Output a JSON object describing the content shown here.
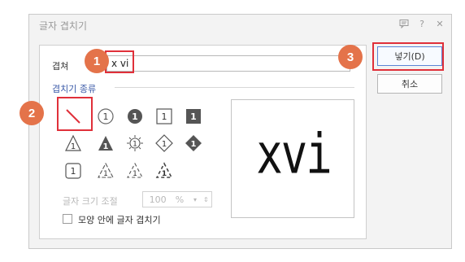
{
  "dialog": {
    "title": "글자 겹치기",
    "title_icons": [
      "comment-icon",
      "help-icon",
      "close-icon"
    ]
  },
  "form": {
    "text_label": "겹쳐",
    "text_value": "x vi",
    "section_title": "겹치기 종류",
    "size_label": "글자 크기 조절",
    "size_value": "100",
    "size_unit": "%",
    "shape_checkbox_label": "모양 안에 글자 겹치기",
    "shape_checkbox_checked": false
  },
  "symbols": {
    "row1": [
      "none",
      "1",
      "1",
      "1",
      "1"
    ],
    "row2": [
      "1",
      "1",
      "1",
      "1",
      "1"
    ],
    "row3": [
      "1",
      "1",
      "1",
      "1"
    ]
  },
  "preview": {
    "text": "xvi"
  },
  "buttons": {
    "ok_label": "넣기(D)",
    "cancel_label": "취소"
  },
  "markers": [
    "1",
    "2",
    "3"
  ],
  "colors": {
    "highlight": "#e0303a",
    "marker": "#e4734a",
    "section": "#3b5aa8"
  }
}
